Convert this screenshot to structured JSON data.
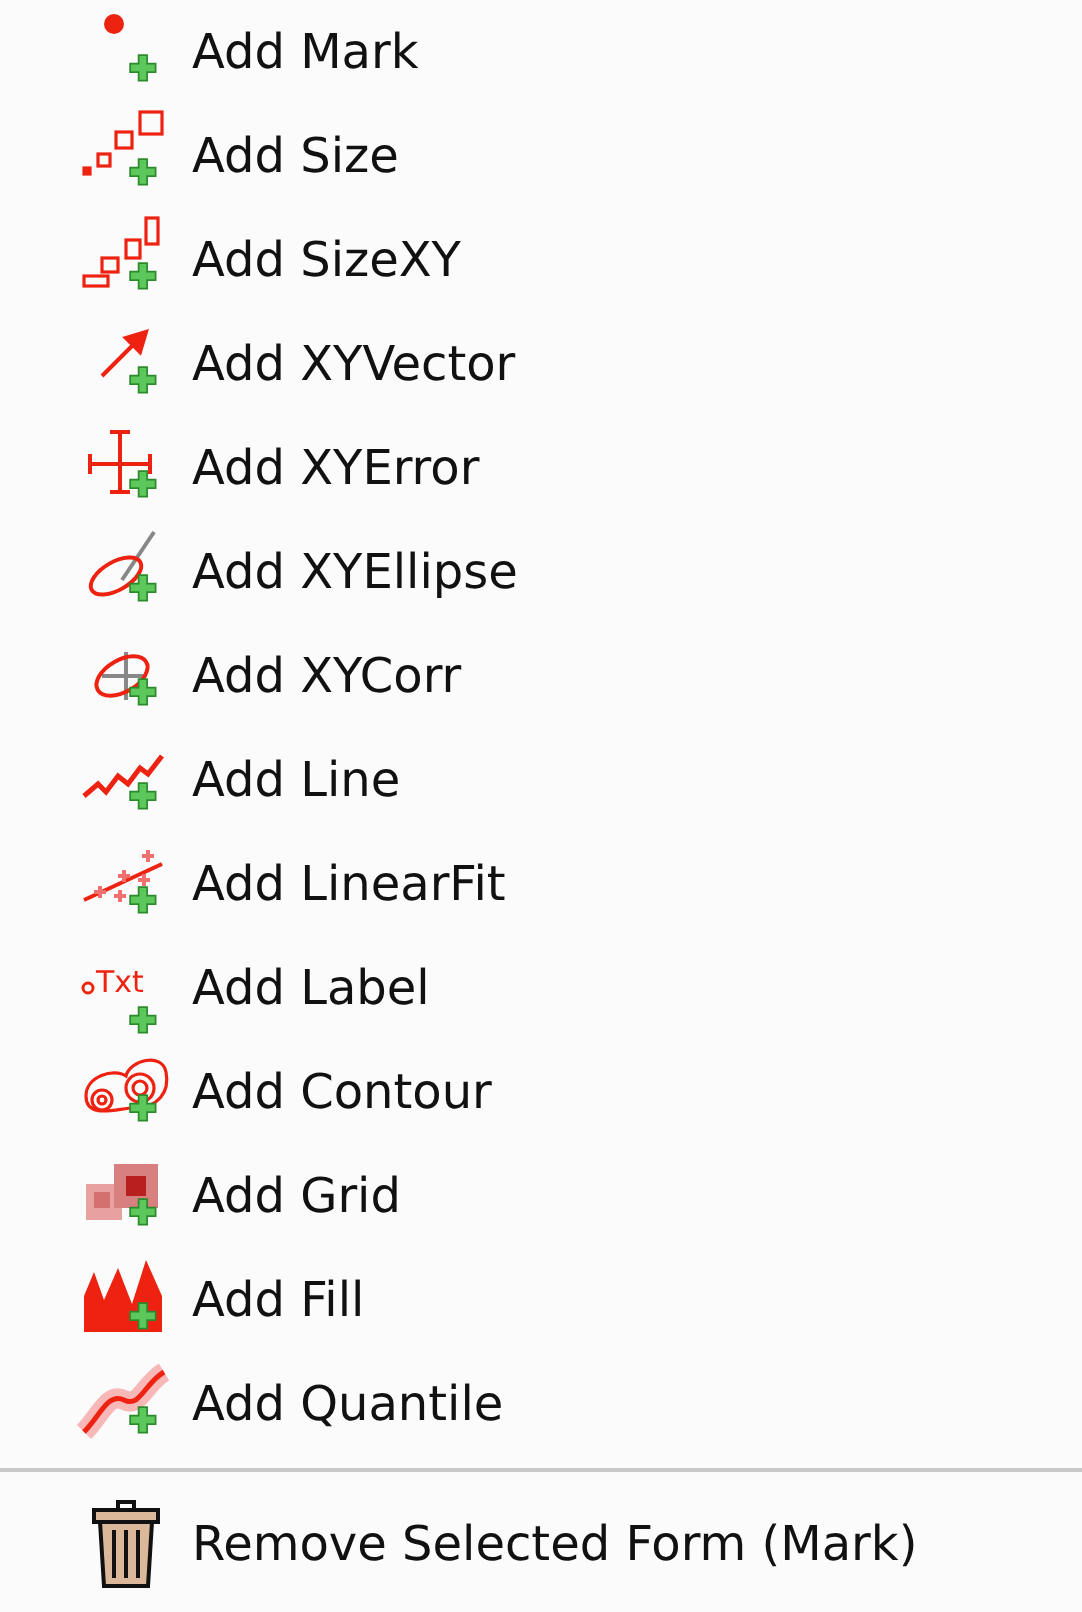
{
  "menu": {
    "items": [
      {
        "kind": "mark",
        "label": "Add Mark"
      },
      {
        "kind": "size",
        "label": "Add Size"
      },
      {
        "kind": "sizexy",
        "label": "Add SizeXY"
      },
      {
        "kind": "vector",
        "label": "Add XYVector"
      },
      {
        "kind": "error",
        "label": "Add XYError"
      },
      {
        "kind": "ellipse",
        "label": "Add XYEllipse"
      },
      {
        "kind": "corr",
        "label": "Add XYCorr"
      },
      {
        "kind": "line",
        "label": "Add Line"
      },
      {
        "kind": "fit",
        "label": "Add LinearFit"
      },
      {
        "kind": "label",
        "label": "Add Label",
        "icon_text": "Txt"
      },
      {
        "kind": "contour",
        "label": "Add Contour"
      },
      {
        "kind": "grid",
        "label": "Add Grid"
      },
      {
        "kind": "fill",
        "label": "Add Fill"
      },
      {
        "kind": "quantile",
        "label": "Add Quantile"
      }
    ],
    "remove": {
      "label": "Remove Selected Form (Mark)"
    }
  }
}
